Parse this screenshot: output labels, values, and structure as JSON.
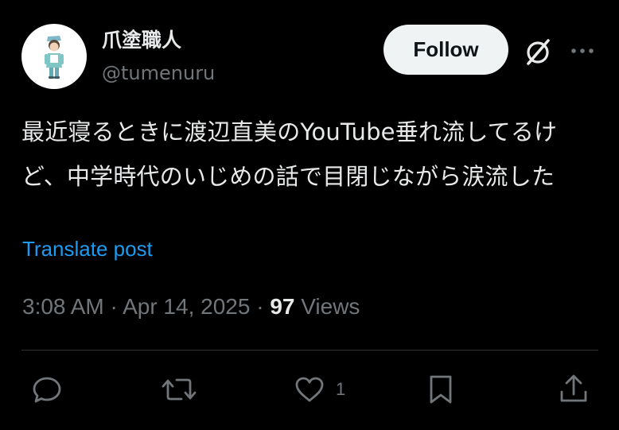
{
  "author": {
    "display_name": "爪塗職人",
    "handle": "@tumenuru",
    "avatar_icon": "nurse-character-avatar"
  },
  "header": {
    "follow_label": "Follow",
    "grok_icon": "grok-slash-icon",
    "more_icon": "more-dots-icon"
  },
  "post": {
    "text": "最近寝るときに渡辺直美のYouTube垂れ流してるけど、中学時代のいじめの話で目閉じながら涙流した",
    "translate_label": "Translate post"
  },
  "meta": {
    "time": "3:08 AM",
    "separator": "·",
    "date": "Apr 14, 2025",
    "views_count": "97",
    "views_label": "Views"
  },
  "actions": {
    "reply_icon": "reply-bubble-icon",
    "repost_icon": "repost-arrows-icon",
    "like_icon": "heart-icon",
    "like_count": "1",
    "bookmark_icon": "bookmark-icon",
    "share_icon": "share-upload-icon"
  },
  "colors": {
    "background": "#000000",
    "text_primary": "#e7e9ea",
    "text_secondary": "#71767b",
    "link": "#1d9bf0",
    "follow_button_bg": "#eff3f4",
    "divider": "#2f3336"
  }
}
